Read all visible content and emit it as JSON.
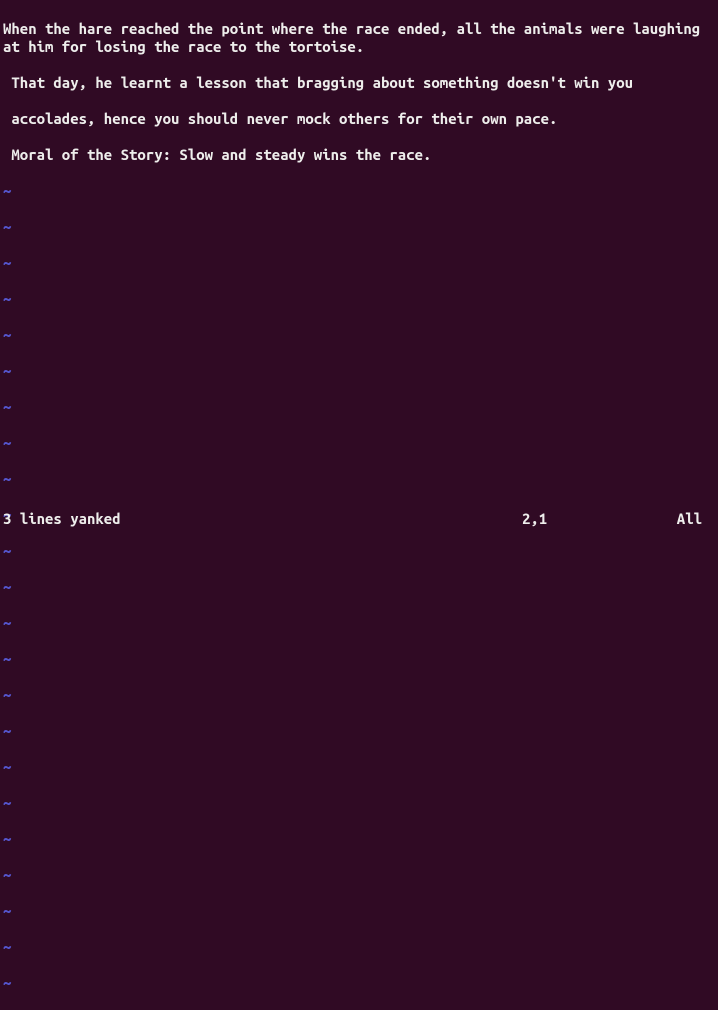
{
  "buffer": {
    "line1": "When the hare reached the point where the race ended, all the animals were laughing at him for losing the race to the tortoise.",
    "line2": " That day, he learnt a lesson that bragging about something doesn't win you",
    "line3": " accolades, hence you should never mock others for their own pace.",
    "line4": " Moral of the Story: Slow and steady wins the race."
  },
  "tilde": "~",
  "status": {
    "message": "3 lines yanked",
    "position": "2,1",
    "scroll": "All"
  }
}
